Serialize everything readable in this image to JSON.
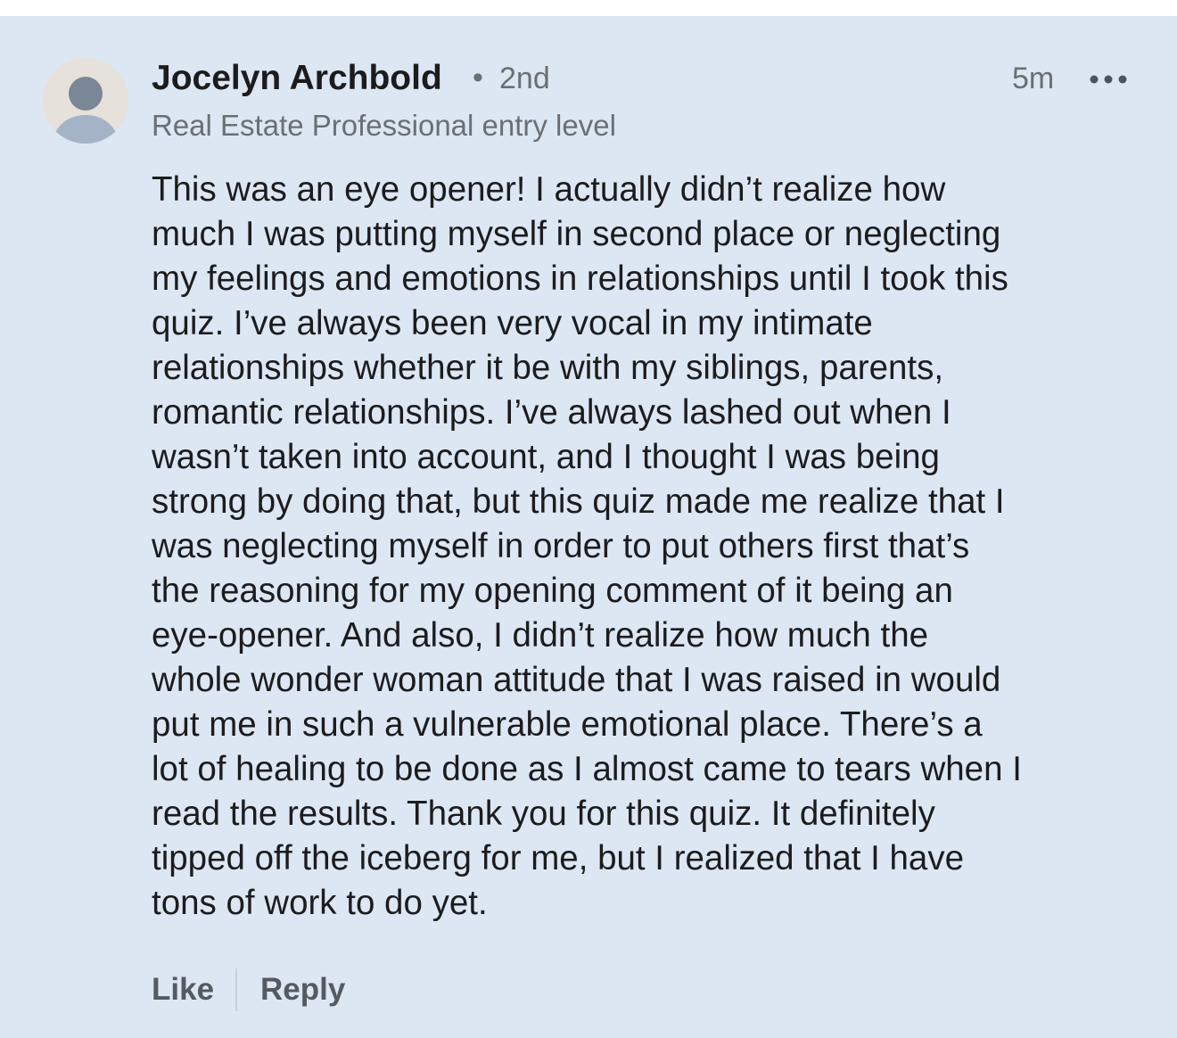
{
  "comment": {
    "author_name": "Jocelyn Archbold",
    "separator": "•",
    "connection_degree": "2nd",
    "headline": "Real Estate Professional entry level",
    "timestamp": "5m",
    "more_icon": "more-horizontal-icon",
    "avatar_icon": "default-person-avatar",
    "text_lines": [
      "This was an eye opener! I actually didn’t realize how",
      "much I was putting myself in second place or neglecting",
      "my feelings and emotions in relationships until I took this",
      "quiz. I’ve always been very vocal in my intimate",
      "relationships whether it be with my siblings, parents,",
      "romantic relationships. I’ve always lashed out when I",
      "wasn’t taken into account, and I thought I was being",
      "strong by doing that, but this quiz made me realize that I",
      "was neglecting myself in order to put others first that’s",
      "the reasoning for my opening comment of it being an",
      "eye-opener. And also, I didn’t realize how much the",
      "whole wonder woman attitude that I was raised in would",
      "put me in such a vulnerable emotional place. There’s a",
      "lot of healing to be done as I almost came to tears when I",
      "read the results. Thank you for this quiz. It definitely",
      "tipped off the iceberg for me, but I realized that I have",
      "tons of work to do yet."
    ]
  },
  "actions": {
    "like_label": "Like",
    "reply_label": "Reply"
  },
  "colors": {
    "card_background": "#dce7f3",
    "primary_text": "#1c1c1e",
    "secondary_text": "#6b6f74",
    "action_text": "#545a60"
  }
}
